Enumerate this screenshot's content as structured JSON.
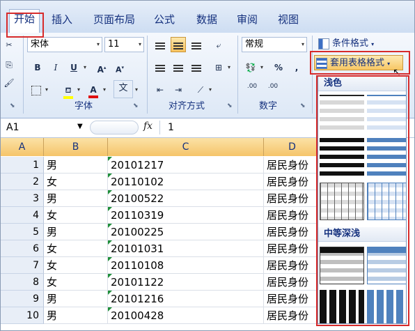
{
  "tabs": [
    {
      "label": "开始",
      "active": true
    },
    {
      "label": "插入"
    },
    {
      "label": "页面布局"
    },
    {
      "label": "公式"
    },
    {
      "label": "数据"
    },
    {
      "label": "审阅"
    },
    {
      "label": "视图"
    }
  ],
  "font": {
    "name": "宋体",
    "size": "11",
    "group_label": "字体"
  },
  "align": {
    "group_label": "对齐方式"
  },
  "number": {
    "format": "常规",
    "percent": "%",
    "comma": ",",
    "inc_decimal": ".00",
    "dec_decimal": ".00",
    "group_label": "数字"
  },
  "styles": {
    "conditional": "条件格式",
    "table_format": "套用表格格式"
  },
  "gallery": {
    "light_label": "浅色",
    "medium_label": "中等深浅"
  },
  "formula_bar": {
    "cell_ref": "A1",
    "fx": "fx",
    "value": "1"
  },
  "columns": [
    "A",
    "B",
    "C",
    "D"
  ],
  "rows": [
    {
      "n": "1",
      "gender": "男",
      "date": "20101217",
      "id": "居民身份"
    },
    {
      "n": "2",
      "gender": "女",
      "date": "20110102",
      "id": "居民身份"
    },
    {
      "n": "3",
      "gender": "男",
      "date": "20100522",
      "id": "居民身份"
    },
    {
      "n": "4",
      "gender": "女",
      "date": "20110319",
      "id": "居民身份"
    },
    {
      "n": "5",
      "gender": "男",
      "date": "20100225",
      "id": "居民身份"
    },
    {
      "n": "6",
      "gender": "女",
      "date": "20101031",
      "id": "居民身份"
    },
    {
      "n": "7",
      "gender": "女",
      "date": "20110108",
      "id": "居民身份"
    },
    {
      "n": "8",
      "gender": "女",
      "date": "20101122",
      "id": "居民身份"
    },
    {
      "n": "9",
      "gender": "男",
      "date": "20101216",
      "id": "居民身份"
    },
    {
      "n": "10",
      "gender": "男",
      "date": "20100428",
      "id": "居民身份"
    }
  ],
  "colors": {
    "highlight": "#d72b2b",
    "accent": "#15317e"
  }
}
